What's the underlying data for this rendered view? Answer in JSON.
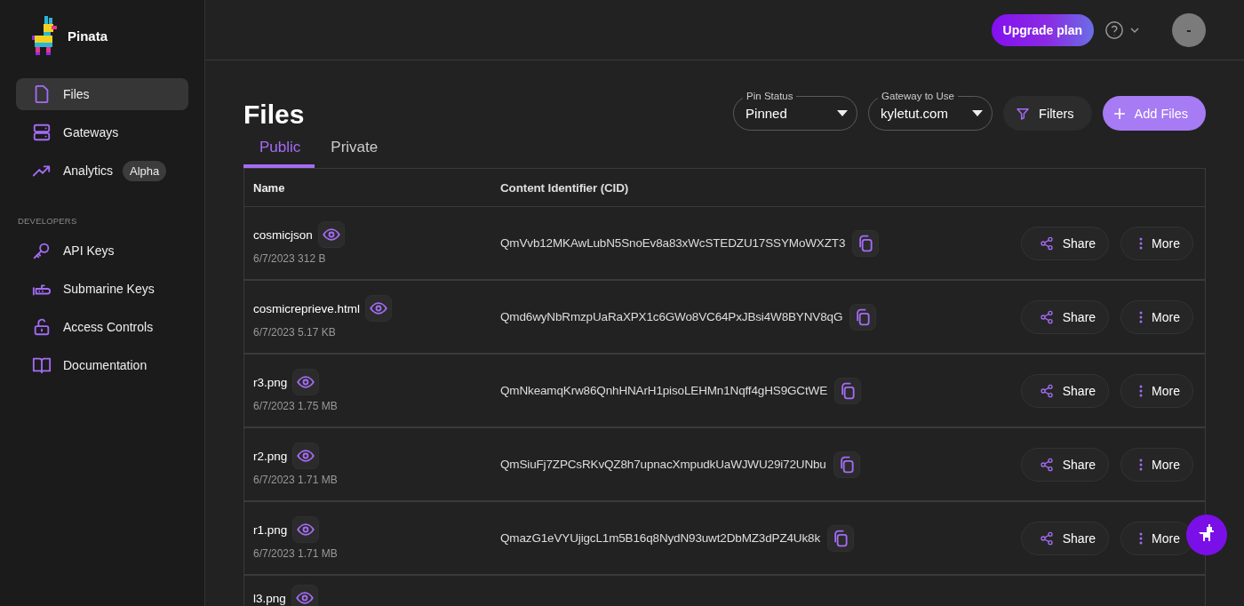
{
  "sidebar": {
    "brand": "Pinata",
    "items": [
      {
        "label": "Files",
        "selected": true
      },
      {
        "label": "Gateways",
        "selected": false
      },
      {
        "label": "Analytics",
        "selected": false,
        "badge": "Alpha"
      }
    ],
    "section_title": "DEVELOPERS",
    "developer_items": [
      {
        "label": "API Keys",
        "selected": false
      },
      {
        "label": "Submarine Keys",
        "selected": false
      },
      {
        "label": "Access Controls",
        "selected": false
      },
      {
        "label": "Documentation",
        "selected": false
      }
    ]
  },
  "top_bar": {
    "upgrade_button": "Upgrade plan",
    "avatar": "-"
  },
  "page": {
    "title": "Files",
    "tabs": [
      {
        "label": "Public",
        "selected": true
      },
      {
        "label": "Private",
        "selected": false
      }
    ],
    "pin_status": {
      "label": "Pin Status",
      "value": "Pinned"
    },
    "gateway": {
      "label": "Gateway to Use",
      "value": "kyletut.com"
    },
    "filters_button": "Filters",
    "add_button": "Add Files"
  },
  "table": {
    "columns": [
      "Name",
      "Content Identifier (CID)"
    ],
    "rows": [
      {
        "name": "cosmicjson",
        "meta": "6/7/2023 312 B",
        "cid": "QmVvb12MKAwLubN5SnoEv8a83xWcSTEDZU17SSYMoWXZT3",
        "share": "Share",
        "more": "More"
      },
      {
        "name": "cosmicreprieve.html",
        "meta": "6/7/2023 5.17 KB",
        "cid": "Qmd6wyNbRmzpUaRaXPX1c6GWo8VC64PxJBsi4W8BYNV8qG",
        "share": "Share",
        "more": "More"
      },
      {
        "name": "r3.png",
        "meta": "6/7/2023 1.75 MB",
        "cid": "QmNkeamqKrw86QnhHNArH1pisoLEHMn1Nqff4gHS9GCtWE",
        "share": "Share",
        "more": "More"
      },
      {
        "name": "r2.png",
        "meta": "6/7/2023 1.71 MB",
        "cid": "QmSiuFj7ZPCsRKvQZ8h7upnacXmpudkUaWJWU29i72UNbu",
        "share": "Share",
        "more": "More"
      },
      {
        "name": "r1.png",
        "meta": "6/7/2023 1.71 MB",
        "cid": "QmazG1eVYUjigcL1m5B16q8NydN93uwt2DbMZ3dPZ4Uk8k",
        "share": "Share",
        "more": "More"
      },
      {
        "name": "l3.png"
      }
    ]
  }
}
